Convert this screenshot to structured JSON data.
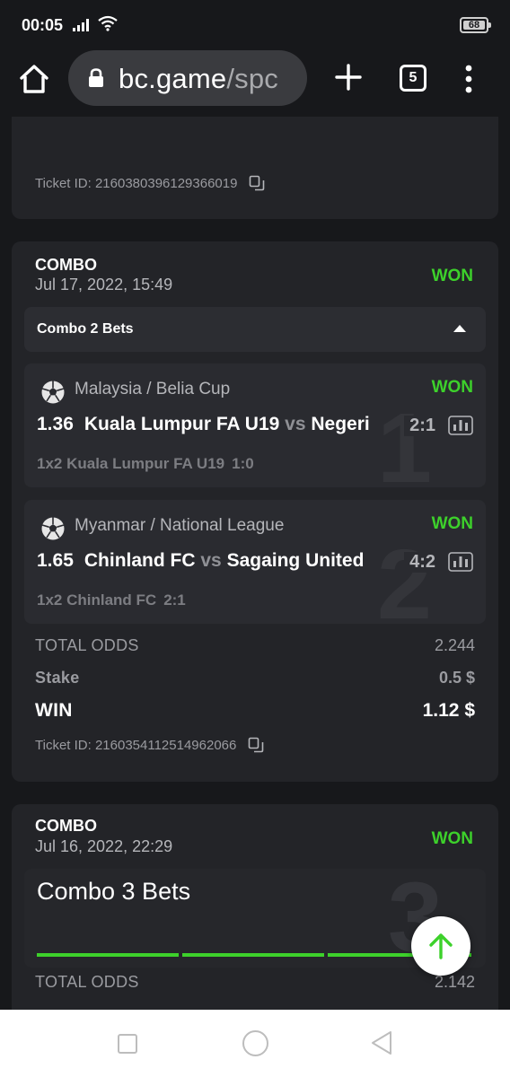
{
  "status_bar": {
    "time": "00:05",
    "battery": "68"
  },
  "browser": {
    "url_main": "bc.game",
    "url_path": "/spc",
    "tab_count": "5"
  },
  "top_card": {
    "ticket_id": "Ticket ID: 2160380396129366019"
  },
  "combo1": {
    "type": "COMBO",
    "date": "Jul 17, 2022, 15:49",
    "status": "WON",
    "toggle_label": "Combo 2 Bets",
    "bets": [
      {
        "number": "1",
        "league": "Malaysia / Belia Cup",
        "status": "WON",
        "odds": "1.36",
        "home": "Kuala Lumpur FA U19",
        "vs": "vs",
        "away": "Negeri",
        "score": "2:1",
        "pick": "1x2 Kuala Lumpur FA U19",
        "pick_result": "1:0"
      },
      {
        "number": "2",
        "league": "Myanmar / National League",
        "status": "WON",
        "odds": "1.65",
        "home": "Chinland FC",
        "vs": "vs",
        "away": "Sagaing United",
        "score": "4:2",
        "pick": "1x2 Chinland FC",
        "pick_result": "2:1"
      }
    ],
    "total_odds_label": "TOTAL ODDS",
    "total_odds": "2.244",
    "stake_label": "Stake",
    "stake": "0.5 $",
    "win_label": "WIN",
    "win": "1.12 $",
    "ticket_id": "Ticket ID: 2160354112514962066"
  },
  "combo2": {
    "type": "COMBO",
    "date": "Jul 16, 2022, 22:29",
    "status": "WON",
    "toggle_label": "Combo 3 Bets",
    "number": "3",
    "total_odds_label": "TOTAL ODDS",
    "total_odds": "2.142",
    "progress_segments_won": 3
  },
  "colors": {
    "won": "#3dd12b",
    "card": "#232428",
    "background": "#17181b"
  },
  "icons": [
    "signal-icon",
    "wifi-icon",
    "home-icon",
    "lock-icon",
    "plus-icon",
    "menu-icon",
    "copy-icon",
    "soccer-ball-icon",
    "stats-icon",
    "arrow-up-icon"
  ]
}
